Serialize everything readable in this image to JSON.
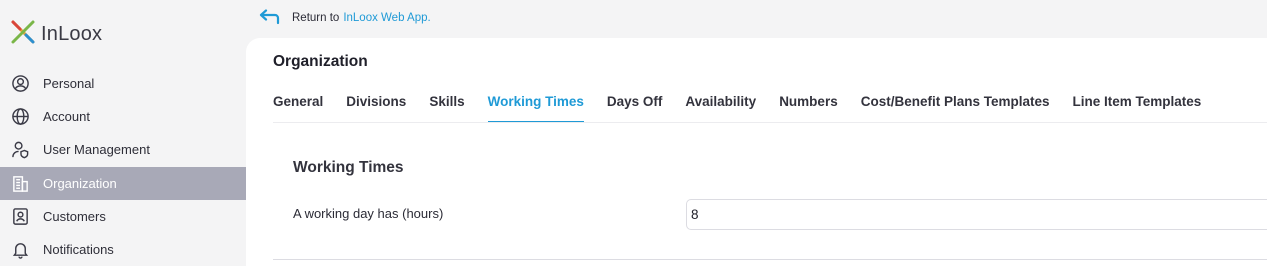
{
  "app": {
    "logo_text": "InLoox",
    "colors": {
      "accent": "#1f9ad6",
      "active_nav": "#a8a9b7"
    }
  },
  "sidebar": {
    "items": [
      {
        "label": "Personal",
        "icon": "person-circle-icon"
      },
      {
        "label": "Account",
        "icon": "globe-icon"
      },
      {
        "label": "User Management",
        "icon": "user-shield-icon"
      },
      {
        "label": "Organization",
        "icon": "building-icon",
        "active": true
      },
      {
        "label": "Customers",
        "icon": "contact-card-icon"
      },
      {
        "label": "Notifications",
        "icon": "bell-icon"
      }
    ]
  },
  "returnbar": {
    "text": "Return to",
    "link": "InLoox Web App."
  },
  "main": {
    "title": "Organization",
    "tabs": [
      {
        "label": "General"
      },
      {
        "label": "Divisions"
      },
      {
        "label": "Skills"
      },
      {
        "label": "Working Times",
        "active": true
      },
      {
        "label": "Days Off"
      },
      {
        "label": "Availability"
      },
      {
        "label": "Numbers"
      },
      {
        "label": "Cost/Benefit Plans Templates"
      },
      {
        "label": "Line Item Templates"
      }
    ],
    "section_title": "Working Times",
    "field": {
      "label": "A working day has (hours)",
      "value": "8"
    }
  }
}
